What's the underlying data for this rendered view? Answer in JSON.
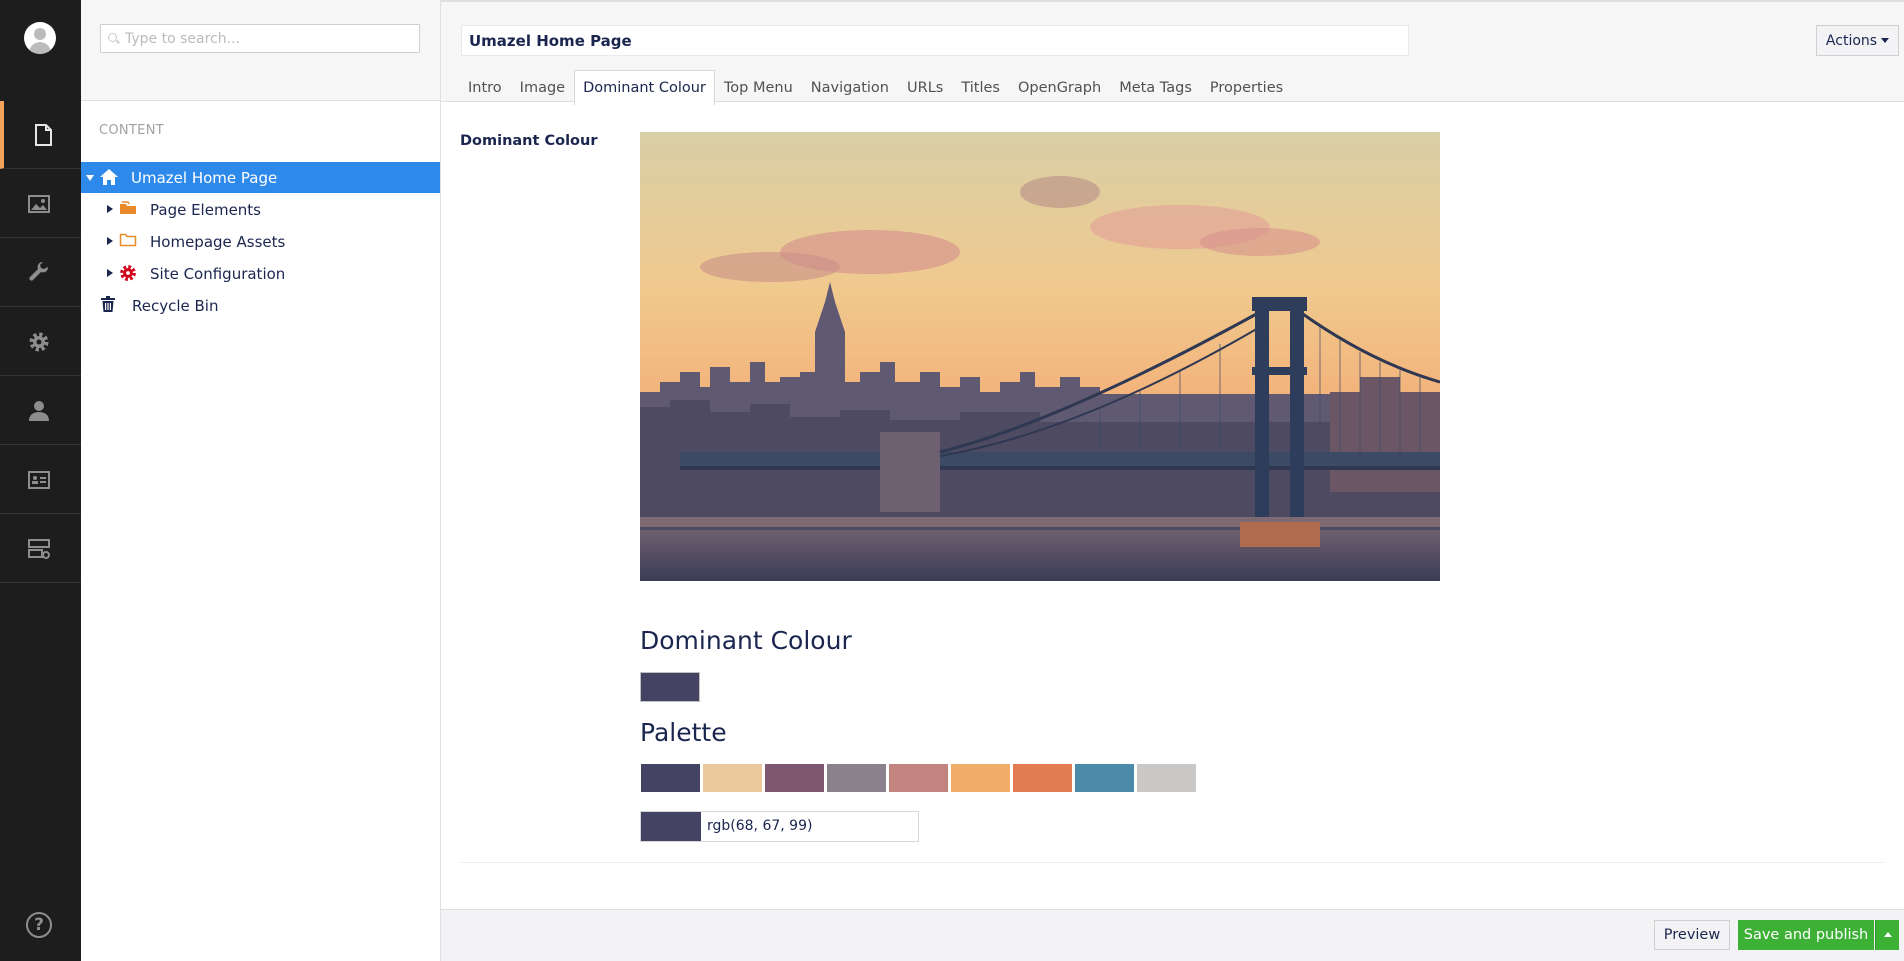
{
  "colors": {
    "dominant": "#444363",
    "palette": [
      "#444363",
      "#ecc99d",
      "#7e5870",
      "#8b818d",
      "#c3847f",
      "#f2ac69",
      "#e27b4f",
      "#4b8ba9",
      "#c9c8c7"
    ]
  },
  "search": {
    "placeholder": "Type to search..."
  },
  "tree": {
    "heading": "CONTENT",
    "items": [
      {
        "label": "Umazel Home Page",
        "icon": "home-icon"
      },
      {
        "label": "Page Elements",
        "icon": "folder-open-icon"
      },
      {
        "label": "Homepage Assets",
        "icon": "folder-icon"
      },
      {
        "label": "Site Configuration",
        "icon": "settings-gear-icon"
      },
      {
        "label": "Recycle Bin",
        "icon": "trash-icon"
      }
    ]
  },
  "header": {
    "node_name": "Umazel Home Page",
    "actions_label": "Actions",
    "tabs": [
      "Intro",
      "Image",
      "Dominant Colour",
      "Top Menu",
      "Navigation",
      "URLs",
      "Titles",
      "OpenGraph",
      "Meta Tags",
      "Properties"
    ]
  },
  "property": {
    "label": "Dominant Colour",
    "dominant_heading": "Dominant Colour",
    "palette_heading": "Palette",
    "picker_value": "rgb(68, 67, 99)"
  },
  "footer": {
    "preview_label": "Preview",
    "publish_label": "Save and publish"
  }
}
